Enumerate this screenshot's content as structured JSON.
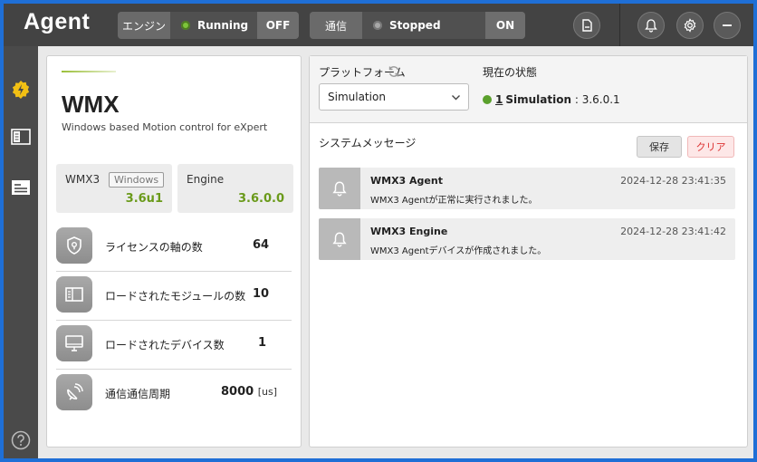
{
  "header": {
    "title": "Agent",
    "engine": {
      "label": "エンジン",
      "status": "Running",
      "status_color": "#7dc43a",
      "button": "OFF"
    },
    "comm": {
      "label": "通信",
      "status": "Stopped",
      "status_color": "#9a9a9a",
      "button": "ON"
    },
    "icons": [
      "sd-card-icon",
      "bell-icon",
      "gear-icon",
      "minimize-icon"
    ]
  },
  "sidebar": {
    "items": [
      "lightning-icon",
      "module-panel-icon",
      "id-card-icon"
    ],
    "help_icon": "help-icon"
  },
  "left": {
    "title": "WMX",
    "subtitle": "Windows based Motion control for eXpert",
    "versions": [
      {
        "name": "WMX3",
        "badge": "Windows",
        "value": "3.6u1"
      },
      {
        "name": "Engine",
        "badge": "",
        "value": "3.6.0.0"
      }
    ],
    "stats": [
      {
        "icon": "location-shield-icon",
        "label": "ライセンスの軸の数",
        "value": "64",
        "unit": ""
      },
      {
        "icon": "module-icon",
        "label": "ロードされたモジュールの数",
        "value": "10",
        "unit": ""
      },
      {
        "icon": "monitor-icon",
        "label": "ロードされたデバイス数",
        "value": "1",
        "unit": ""
      },
      {
        "icon": "satellite-dish-icon",
        "label": "通信通信周期",
        "value": "8000",
        "unit": "[us]"
      }
    ]
  },
  "right": {
    "platform_label": "プラットフォーム",
    "platform_value": "Simulation",
    "current_state_label": "現在の状態",
    "current_state": {
      "index": "1",
      "name": "Simulation",
      "sep": " : ",
      "version": "3.6.0.1",
      "dot_color": "#5aa02c"
    },
    "system_message_label": "システムメッセージ",
    "save_label": "保存",
    "clear_label": "クリア",
    "messages": [
      {
        "title": "WMX3 Agent",
        "time": "2024-12-28 23:41:35",
        "body": "WMX3 Agentが正常に実行されました。"
      },
      {
        "title": "WMX3 Engine",
        "time": "2024-12-28 23:41:42",
        "body": "WMX3 Agentデバイスが作成されました。"
      }
    ]
  },
  "colors": {
    "accent_green": "#6a9a1a",
    "header_bg": "#434343",
    "sidebar_active": "#f2c014"
  }
}
